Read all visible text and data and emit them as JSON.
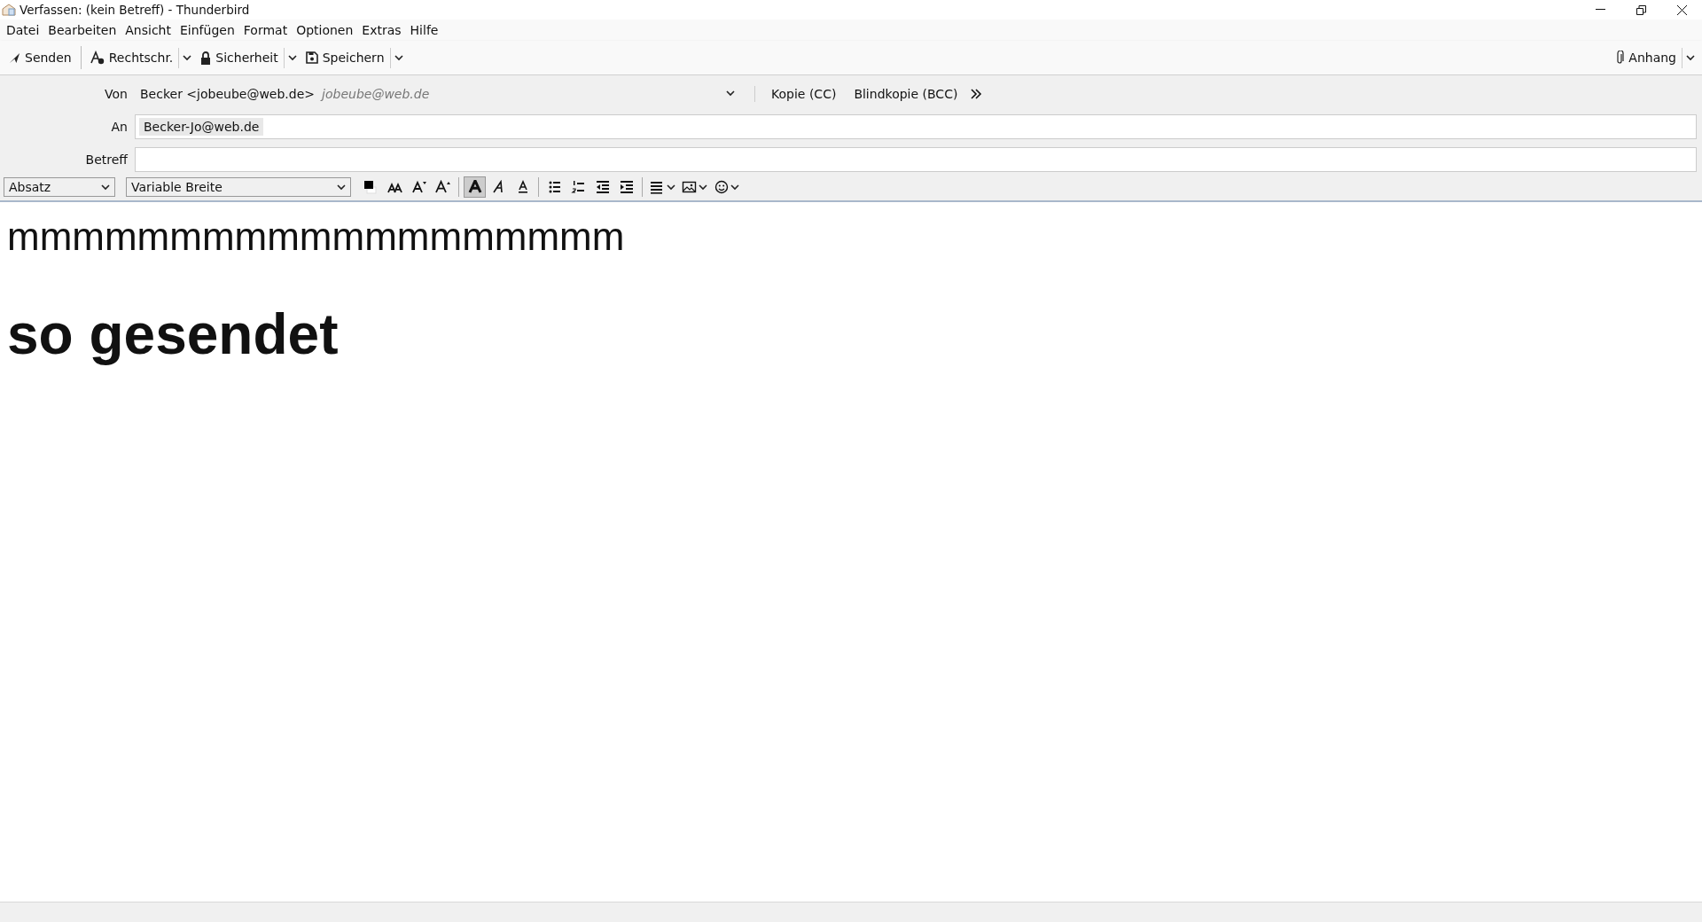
{
  "window": {
    "title": "Verfassen: (kein Betreff) - Thunderbird"
  },
  "menu": [
    "Datei",
    "Bearbeiten",
    "Ansicht",
    "Einfügen",
    "Format",
    "Optionen",
    "Extras",
    "Hilfe"
  ],
  "toolbar": [
    {
      "kind": "send",
      "label": "Senden",
      "dropdown": false
    },
    {
      "kind": "spell",
      "label": "Rechtschr.",
      "dropdown": true
    },
    {
      "kind": "lock",
      "label": "Sicherheit",
      "dropdown": true
    },
    {
      "kind": "save",
      "label": "Speichern",
      "dropdown": true
    }
  ],
  "attach": {
    "label": "Anhang"
  },
  "from": {
    "label": "Von",
    "name": "Becker <jobeube@web.de>",
    "address": "jobeube@web.de",
    "cc": "Kopie (CC)",
    "bcc": "Blindkopie (BCC)"
  },
  "to": {
    "label": "An",
    "recipients": [
      "Becker-Jo@web.de"
    ]
  },
  "subject": {
    "label": "Betreff"
  },
  "format": {
    "paragraph": "Absatz",
    "font": "Variable Breite",
    "buttons": [
      {
        "kind": "color",
        "selected": false
      },
      {
        "kind": "smaller",
        "selected": false
      },
      {
        "kind": "shrink",
        "selected": false
      },
      {
        "kind": "grow",
        "selected": false
      },
      {
        "kind": "bold",
        "selected": true
      },
      {
        "kind": "italic",
        "selected": false
      },
      {
        "kind": "underline",
        "selected": false
      },
      {
        "kind": "bullets",
        "selected": false
      },
      {
        "kind": "numbers",
        "selected": false
      },
      {
        "kind": "outdent",
        "selected": false
      },
      {
        "kind": "indent",
        "selected": false
      },
      {
        "kind": "align",
        "selected": false
      },
      {
        "kind": "image",
        "selected": false
      },
      {
        "kind": "emoji",
        "selected": false
      }
    ]
  },
  "body": [
    {
      "kind": "large",
      "text": "mmmmmmmmmmmmmmmmmmm"
    },
    {
      "kind": "heading",
      "text": "so gesendet"
    }
  ]
}
